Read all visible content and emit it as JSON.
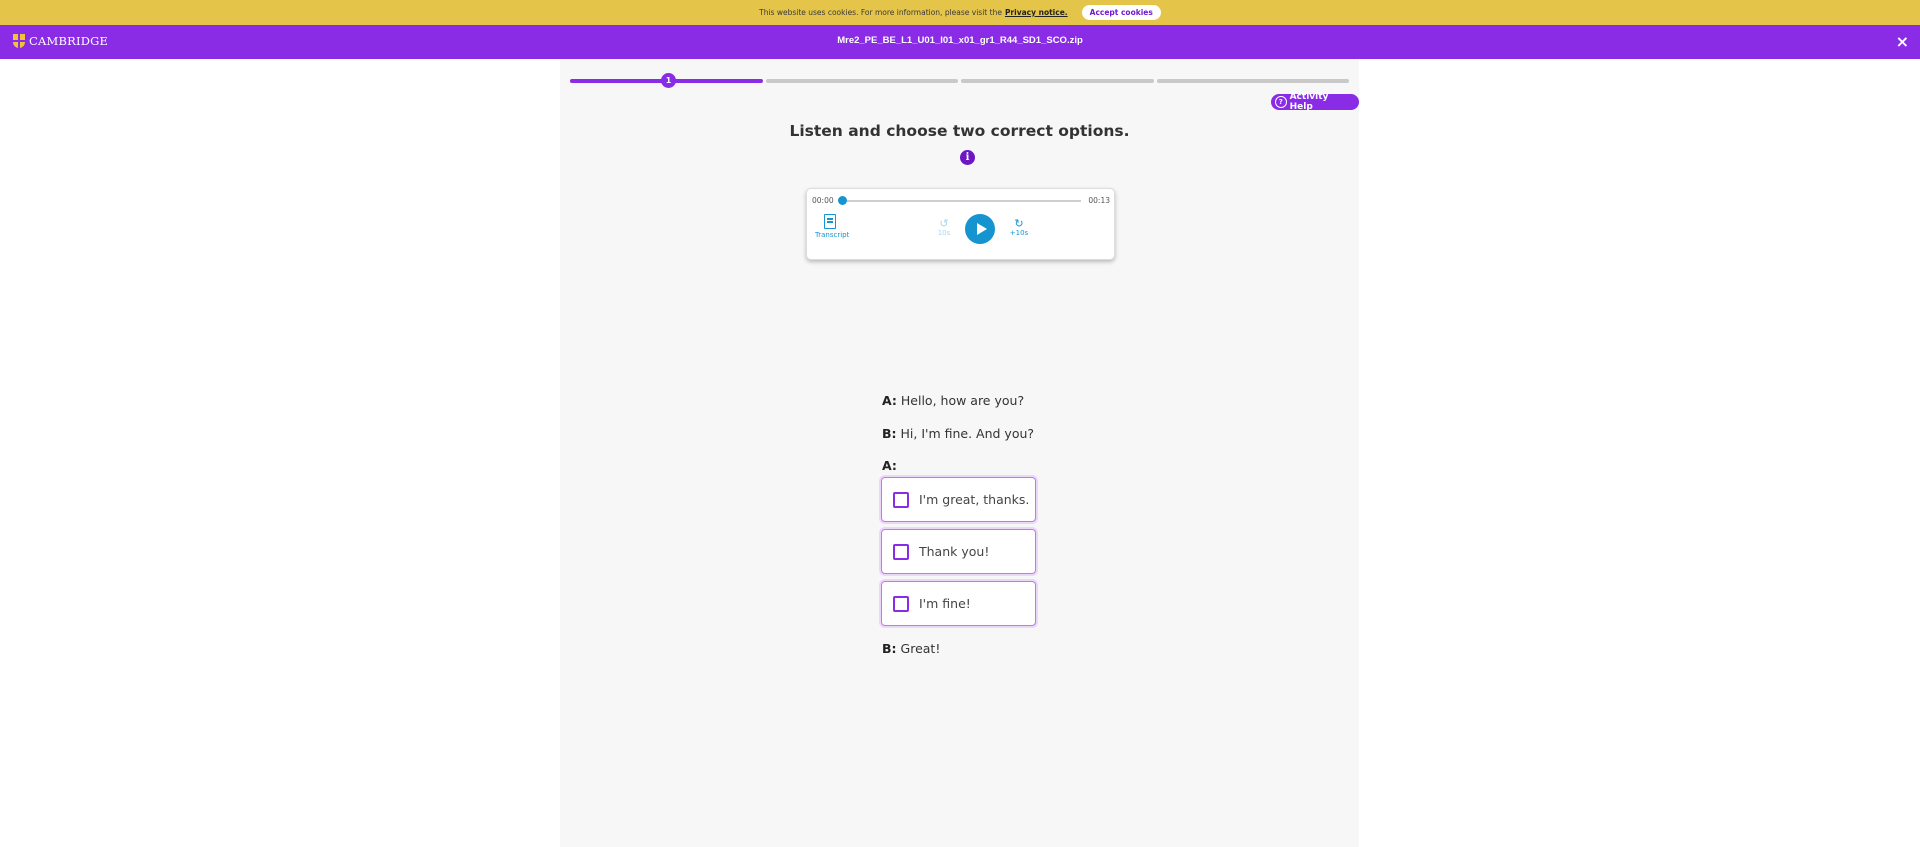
{
  "cookie": {
    "message": "This website uses cookies. For more information, please visit the",
    "link": "Privacy notice.",
    "accept": "Accept cookies"
  },
  "header": {
    "logo": "CAMBRIDGE",
    "title": "Mre2_PE_BE_L1_U01_I01_x01_gr1_R44_SD1_SCO.zip",
    "close": "×"
  },
  "progress": {
    "current_step": "1",
    "total_segments": 4
  },
  "help": {
    "label": "Activity Help",
    "icon": "?"
  },
  "instruction": "Listen and choose two correct options.",
  "info_icon": "i",
  "player": {
    "time_start": "00:00",
    "time_end": "00:13",
    "transcript": "Transcript",
    "back_label": "10s",
    "fwd_label": "+10s",
    "position": 0
  },
  "dialogue": {
    "line1_speaker": "A:",
    "line1_text": "Hello, how are you?",
    "line2_speaker": "B:",
    "line2_text": "Hi, I'm fine. And you?",
    "line3_speaker": "A:",
    "options": [
      "I'm great, thanks.",
      "Thank you!",
      "I'm fine!"
    ],
    "line4_speaker": "B:",
    "line4_text": "Great!"
  }
}
